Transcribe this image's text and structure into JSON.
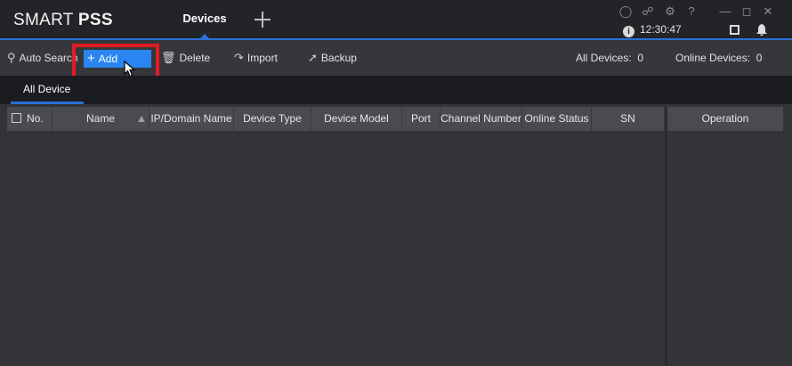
{
  "app": {
    "logo_light": "SMART ",
    "logo_bold": "PSS"
  },
  "tabs": [
    {
      "label": "Devices"
    }
  ],
  "system": {
    "time": "12:30:47",
    "icons": [
      "user-icon",
      "lock-icon",
      "settings-icon",
      "help-icon",
      "minimize-icon",
      "maximize-icon",
      "close-icon"
    ]
  },
  "toolbar": {
    "auto_search": "Auto Search",
    "add": "Add",
    "delete": "Delete",
    "import": "Import",
    "backup": "Backup",
    "all_devices_label": "All Devices:",
    "all_devices_count": "0",
    "online_devices_label": "Online Devices:",
    "online_devices_count": "0"
  },
  "subtabs": [
    {
      "label": "All Device"
    }
  ],
  "grid": {
    "columns": [
      "No.",
      "Name",
      "IP/Domain Name",
      "Device Type",
      "Device Model",
      "Port",
      "Channel Number",
      "Online Status",
      "SN",
      "Operation"
    ],
    "rows": []
  },
  "colors": {
    "accent": "#2b6fd6",
    "add_button": "#2a85f0",
    "highlight": "#e21b24"
  }
}
